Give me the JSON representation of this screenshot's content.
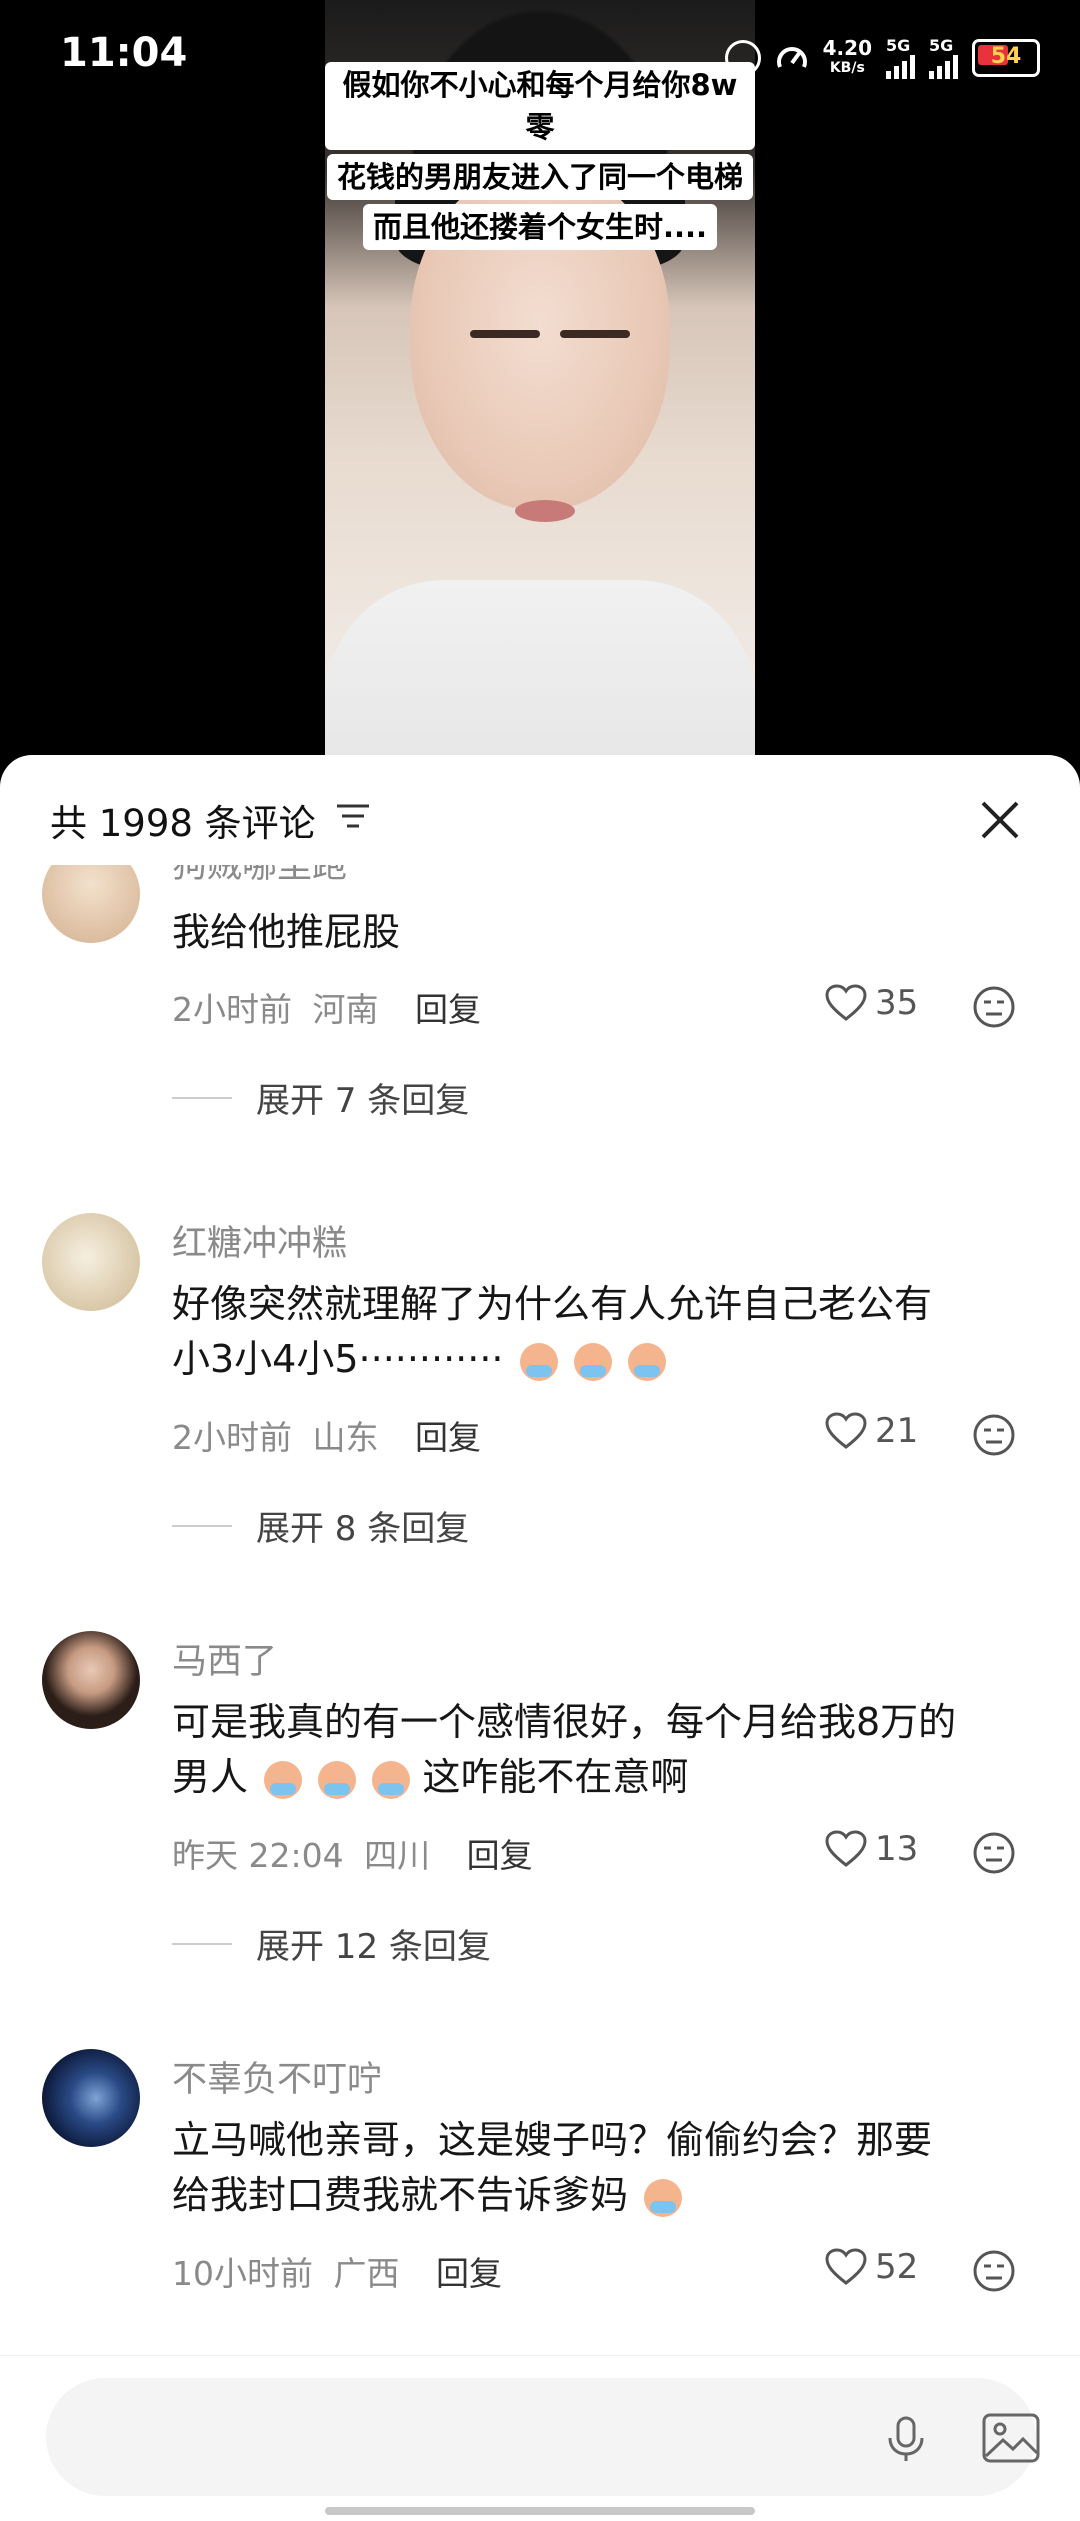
{
  "status_bar": {
    "time": "11:04",
    "net_speed_value": "4.20",
    "net_speed_unit": "KB/s",
    "signal1_label": "5G",
    "signal2_label": "5G",
    "battery": "54"
  },
  "video": {
    "caption_lines": [
      "假如你不小心和每个月给你8w零",
      "花钱的男朋友进入了同一个电梯",
      "而且他还搂着个女生时...."
    ]
  },
  "sheet": {
    "comment_count": "共 1998 条评论",
    "icons": {
      "filter": "filter-icon",
      "close": "close-icon"
    }
  },
  "comments": [
    {
      "username": "狗贼哪里跑",
      "text": "我给他推屁股",
      "time": "2小时前",
      "location": "河南",
      "reply_label": "回复",
      "likes": "35",
      "expand_label": "展开 7 条回复",
      "avatar_color": "#e7cdb6"
    },
    {
      "username": "红糖冲冲糕",
      "text_line1": "好像突然就理解了为什么有人允许自己老公有",
      "text_line2": "小3小4小5············",
      "time": "2小时前",
      "location": "山东",
      "reply_label": "回复",
      "likes": "21",
      "expand_label": "展开 8 条回复",
      "avatar_color": "#ece3d2"
    },
    {
      "username": "马西了",
      "text_line1": "可是我真的有一个感情很好，每个月给我8万的",
      "text_line2_a": "男人",
      "text_line2_b": "这咋能不在意啊",
      "time": "昨天 22:04",
      "location": "四川",
      "reply_label": "回复",
      "likes": "13",
      "expand_label": "展开 12 条回复",
      "avatar_color": "#3c2b25"
    },
    {
      "username": "不辜负不叮咛",
      "text_line1": "立马喊他亲哥，这是嫂子吗？偷偷约会？那要",
      "text_line2": "给我封口费我就不告诉爹妈",
      "time": "10小时前",
      "location": "广西",
      "reply_label": "回复",
      "likes": "52",
      "avatar_color": "#0e1f45"
    }
  ],
  "input": {
    "placeholder": "",
    "icons": {
      "mic": "mic-icon",
      "image": "image-icon"
    }
  }
}
